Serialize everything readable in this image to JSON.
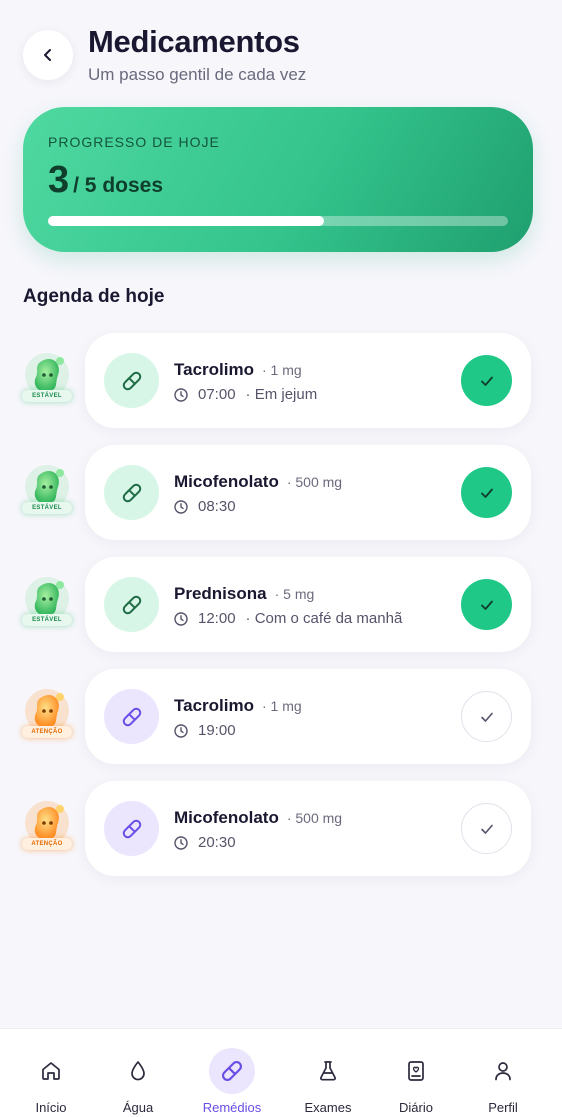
{
  "header": {
    "title": "Medicamentos",
    "subtitle": "Um passo gentil de cada vez",
    "back_icon": "chevron-left-icon"
  },
  "progress": {
    "label": "PROGRESSO DE HOJE",
    "taken": "3",
    "total_text": "/ 5 doses",
    "fraction": 0.6
  },
  "schedule": {
    "title": "Agenda de hoje",
    "items": [
      {
        "name": "Tacrolimo",
        "dose": "· 1 mg",
        "time": "07:00",
        "note": "· Em jejum",
        "status": "ESTÁVEL",
        "taken": true
      },
      {
        "name": "Micofenolato",
        "dose": "· 500 mg",
        "time": "08:30",
        "note": "",
        "status": "ESTÁVEL",
        "taken": true
      },
      {
        "name": "Prednisona",
        "dose": "· 5 mg",
        "time": "12:00",
        "note": "· Com o café da manhã",
        "status": "ESTÁVEL",
        "taken": true
      },
      {
        "name": "Tacrolimo",
        "dose": "· 1 mg",
        "time": "19:00",
        "note": "",
        "status": "ATENÇÃO",
        "taken": false
      },
      {
        "name": "Micofenolato",
        "dose": "· 500 mg",
        "time": "20:30",
        "note": "",
        "status": "ATENÇÃO",
        "taken": false
      }
    ]
  },
  "nav": {
    "items": [
      {
        "label": "Início",
        "icon": "home-icon"
      },
      {
        "label": "Água",
        "icon": "water-drop-icon"
      },
      {
        "label": "Remédios",
        "icon": "pill-icon",
        "active": true
      },
      {
        "label": "Exames",
        "icon": "flask-icon"
      },
      {
        "label": "Diário",
        "icon": "journal-icon"
      },
      {
        "label": "Perfil",
        "icon": "user-icon"
      }
    ]
  },
  "colors": {
    "accent_green": "#1fc886",
    "accent_purple": "#6b4de6",
    "stable_green": "#1c8a4f",
    "warning_orange": "#e06a00"
  }
}
